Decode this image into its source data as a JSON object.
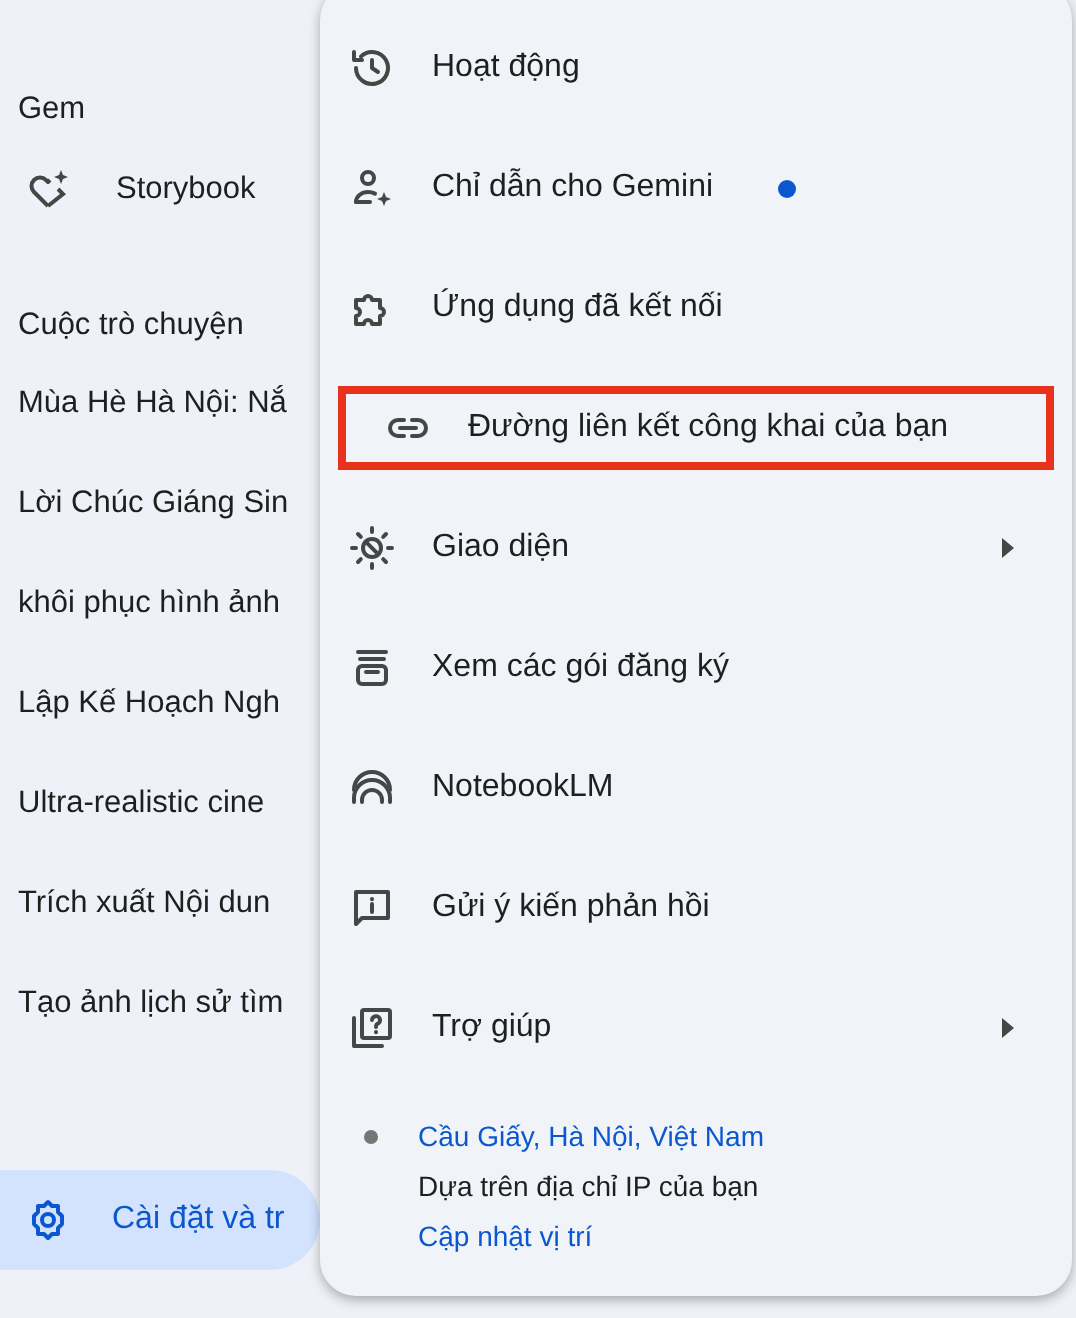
{
  "sidebar": {
    "gem_heading": "Gem",
    "gems": [
      {
        "label": "Storybook"
      }
    ],
    "chats_heading": "Cuộc trò chuyện",
    "chats": [
      "Mùa Hè Hà Nội: Nắ",
      "Lời Chúc Giáng Sin",
      "khôi phục hình ảnh",
      "Lập Kế Hoạch Ngh",
      "Ultra-realistic cine",
      "Trích xuất Nội dun",
      "Tạo ảnh lịch sử tìm"
    ],
    "settings": {
      "label": "Cài đặt và tr",
      "selected": true
    }
  },
  "menu": {
    "items": [
      {
        "label": "Hoạt động",
        "badge": false,
        "submenu": false,
        "highlighted": false
      },
      {
        "label": "Chỉ dẫn cho Gemini",
        "badge": true,
        "submenu": false,
        "highlighted": false
      },
      {
        "label": "Ứng dụng đã kết nối",
        "badge": false,
        "submenu": false,
        "highlighted": false
      },
      {
        "label": "Đường liên kết công khai của bạn",
        "badge": false,
        "submenu": false,
        "highlighted": true
      },
      {
        "label": "Giao diện",
        "badge": false,
        "submenu": true,
        "highlighted": false
      },
      {
        "label": "Xem các gói đăng ký",
        "badge": false,
        "submenu": false,
        "highlighted": false
      },
      {
        "label": "NotebookLM",
        "badge": false,
        "submenu": false,
        "highlighted": false
      },
      {
        "label": "Gửi ý kiến phản hồi",
        "badge": false,
        "submenu": false,
        "highlighted": false
      },
      {
        "label": "Trợ giúp",
        "badge": false,
        "submenu": true,
        "highlighted": false
      }
    ],
    "location": {
      "place": "Cầu Giấy, Hà Nội, Việt Nam",
      "note": "Dựa trên địa chỉ IP của bạn",
      "action": "Cập nhật vị trí"
    }
  }
}
